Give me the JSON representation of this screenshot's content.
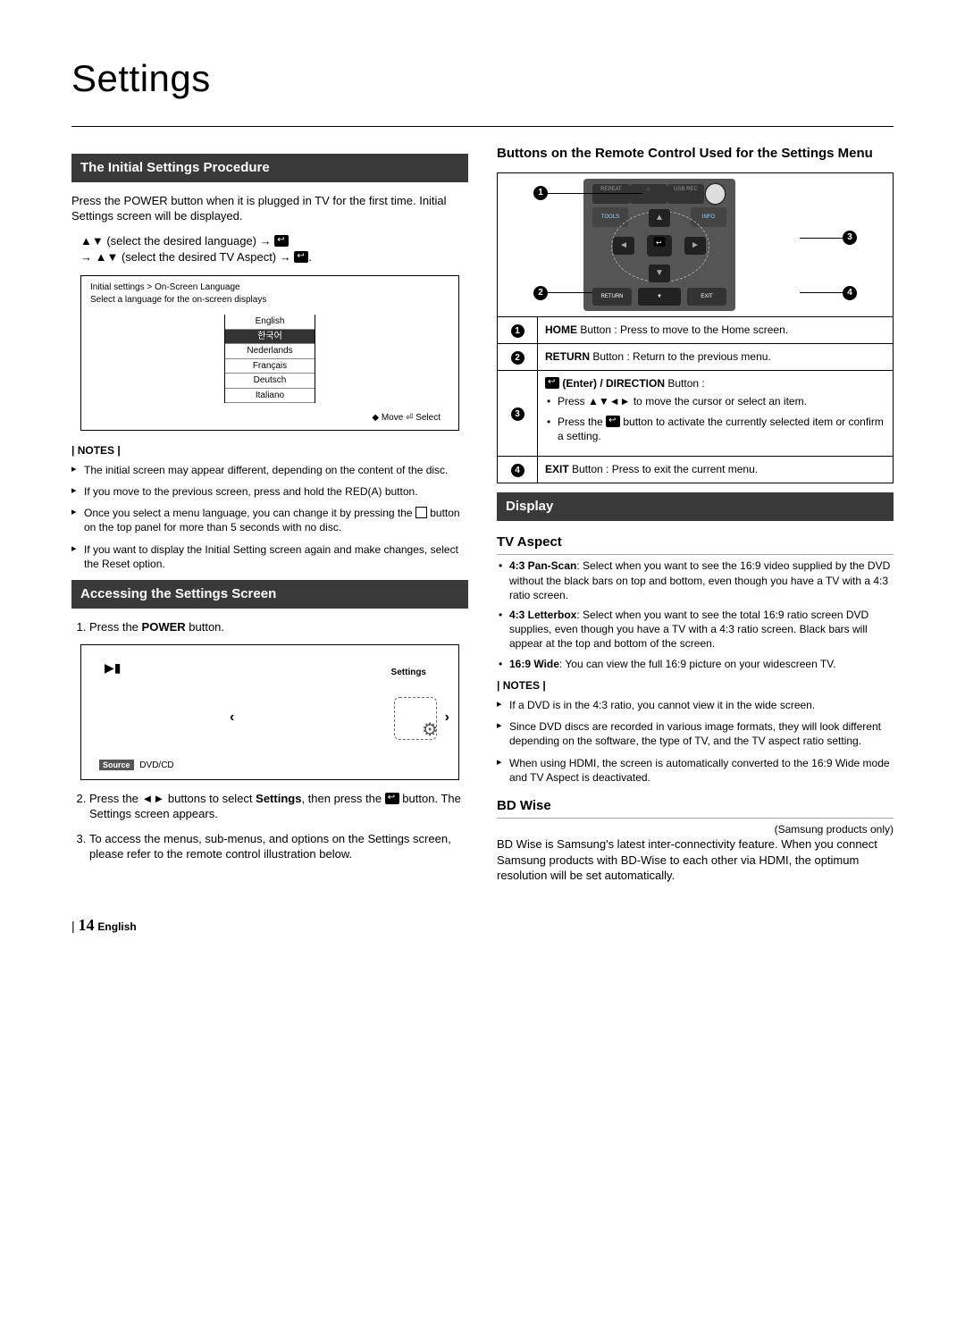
{
  "page_title": "Settings",
  "col_left": {
    "bar1": "The Initial Settings Procedure",
    "intro": "Press the POWER button when it is plugged in TV for the first time. Initial Settings screen will be displayed.",
    "flow_line1_a": "▲▼ (select the desired language) → ",
    "flow_line2_a": "→ ▲▼ (select the desired TV Aspect) → ",
    "langbox": {
      "path": "Initial settings > On-Screen Language",
      "prompt": "Select a language for the on-screen displays",
      "options": [
        "English",
        "한국어",
        "Nederlands",
        "Français",
        "Deutsch",
        "Italiano"
      ],
      "selected": "한국어",
      "foot": "◆ Move   ⏎ Select"
    },
    "notes_label": "| NOTES |",
    "notes1": [
      "The initial screen may appear different, depending on the content of the disc.",
      "If you move to the previous screen, press and hold the RED(A) button.",
      "Once you select a menu language, you can change it by pressing the ■ button on the top panel for more than 5 seconds with no disc.",
      "If you want to display the Initial Setting screen again and make changes, select the Reset option."
    ],
    "bar2": "Accessing the Settings Screen",
    "step1_a": "Press the ",
    "step1_power": "POWER",
    "step1_b": " button.",
    "ui": {
      "settings_label": "Settings",
      "source": "Source",
      "src_val": "DVD/CD"
    },
    "step2_a": "Press the ◄► buttons to select ",
    "step2_settings": "Settings",
    "step2_b": ", then press the ",
    "step2_c": " button. The Settings screen appears.",
    "step3": "To access the menus, sub-menus, and options on the Settings screen, please refer to the remote control illustration below."
  },
  "col_right": {
    "subtitle": "Buttons on the Remote Control Used for the Settings Menu",
    "remote_labels": {
      "repeat": "REPEAT",
      "home": "HOME",
      "usb": "USB REC",
      "tools": "TOOLS",
      "info": "INFO",
      "return": "RETURN",
      "exit": "EXIT"
    },
    "refs": {
      "r1_a": "HOME",
      "r1_b": " Button : Press to move to the Home screen.",
      "r2_a": "RETURN",
      "r2_b": " Button : Return to the previous menu.",
      "r3_title": " (Enter) / DIRECTION",
      "r3_title_b": " Button :",
      "r3_b1": "Press ▲▼◄► to move the cursor or select an item.",
      "r3_b2a": "Press the ",
      "r3_b2b": " button to activate the currently selected item or confirm a setting.",
      "r4_a": "EXIT",
      "r4_b": " Button : Press to exit the current menu."
    },
    "bar_display": "Display",
    "tvaspect_h": "TV Aspect",
    "tvaspect": [
      {
        "b": "4:3 Pan-Scan",
        "t": ": Select when you want to see the 16:9 video supplied by the DVD without the black bars on top and bottom, even though you have a TV with a 4:3 ratio screen."
      },
      {
        "b": "4:3 Letterbox",
        "t": ": Select when you want to see the total 16:9 ratio screen DVD supplies, even though you have a TV with a 4:3 ratio screen. Black bars will appear at the top and bottom of the screen."
      },
      {
        "b": "16:9 Wide",
        "t": ": You can view the full 16:9 picture on your widescreen TV."
      }
    ],
    "notes_label": "| NOTES |",
    "notes2": [
      "If a DVD is in the 4:3 ratio, you cannot view it in the wide screen.",
      "Since DVD discs are recorded in various image formats, they will look different depending on the software, the type of TV, and the TV aspect ratio setting.",
      "When using HDMI, the screen is automatically converted to the 16:9 Wide mode and TV Aspect is deactivated."
    ],
    "bdwise_h": "BD Wise",
    "bdwise_note": "(Samsung products only)",
    "bdwise_body": " BD Wise is Samsung's latest inter-connectivity feature. When you connect Samsung products with BD-Wise to each other via HDMI, the optimum resolution will be set automatically."
  },
  "footer": {
    "bar": "|",
    "num": "14",
    "lang": "English"
  }
}
